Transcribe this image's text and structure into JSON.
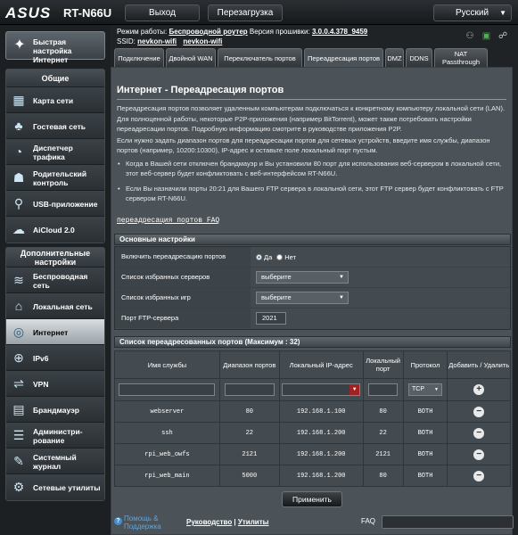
{
  "brand": {
    "logo": "ASUS",
    "model": "RT-N66U"
  },
  "topbar": {
    "logout": "Выход",
    "reboot": "Перезагрузка",
    "language": "Русский"
  },
  "info": {
    "mode_label": "Режим работы:",
    "mode_value": "Беспроводной роутер",
    "fw_label": "Версия прошивки:",
    "fw_value": "3.0.0.4.378_9459",
    "ssid_label": "SSID:",
    "ssid_values": [
      "nevkon-wifi",
      "nevkon-wifi"
    ]
  },
  "sidebar": {
    "quick": "Быстрая настройка Интернет",
    "general_head": "Общие",
    "general": [
      {
        "label": "Карта сети",
        "icon": "network-map-icon",
        "glyph": "▦"
      },
      {
        "label": "Гостевая сеть",
        "icon": "guest-network-icon",
        "glyph": "♣"
      },
      {
        "label": "Диспетчер трафика",
        "icon": "traffic-manager-icon",
        "glyph": "◔"
      },
      {
        "label": "Родительский контроль",
        "icon": "parental-control-icon",
        "glyph": "☗"
      },
      {
        "label": "USB-приложение",
        "icon": "usb-app-icon",
        "glyph": "⚲"
      },
      {
        "label": "AiCloud 2.0",
        "icon": "aicloud-icon",
        "glyph": "☁"
      }
    ],
    "advanced_head": "Дополнительные настройки",
    "advanced": [
      {
        "label": "Беспроводная сеть",
        "icon": "wireless-icon",
        "glyph": "≋"
      },
      {
        "label": "Локальная сеть",
        "icon": "lan-icon",
        "glyph": "⌂"
      },
      {
        "label": "Интернет",
        "icon": "internet-icon",
        "glyph": "◎",
        "active": true
      },
      {
        "label": "IPv6",
        "icon": "ipv6-icon",
        "glyph": "⊕"
      },
      {
        "label": "VPN",
        "icon": "vpn-icon",
        "glyph": "⇌"
      },
      {
        "label": "Брандмауэр",
        "icon": "firewall-icon",
        "glyph": "▤"
      },
      {
        "label": "Администри-рование",
        "icon": "administration-icon",
        "glyph": "☰"
      },
      {
        "label": "Системный журнал",
        "icon": "system-log-icon",
        "glyph": "✎"
      },
      {
        "label": "Сетевые утилиты",
        "icon": "network-tools-icon",
        "glyph": "⚙"
      }
    ]
  },
  "tabs": [
    "Подключение",
    "Двойной WAN",
    "Переключатель портов",
    "Переадресация портов",
    "DMZ",
    "DDNS",
    "NAT Passthrough"
  ],
  "page": {
    "title": "Интернет - Переадресация портов",
    "desc1": "Переадресация портов позволяет удаленным компьютерам подключаться к конкретному компьютеру локальной сети (LAN). Для полноценной работы, некоторые P2P-приложения (например BitTorrent), может также потребовать настройки переадресации портов. Подробную информацию смотрите в руководстве приложения P2P.",
    "desc2": "Если нужно задать диапазон портов для переадресации портов для сетевых устройств, введите имя службы, диапазон портов (например, 10200:10300), IP-адрес и оставьте поле локальный порт пустым.",
    "bullet1": "Когда в Вашей сети отключен брандмауэр и Вы установили 80 порт для использования веб-сервером в локальной сети, этот веб-сервер будет конфликтовать с веб-интерфейсом RT-N66U.",
    "bullet2": "Если Вы назначили порты 20:21 для Вашего FTP сервера в локальной сети, этот FTP сервер будет конфликтовать с FTP сервером RT-N66U.",
    "faq": "переадресация портов FAQ"
  },
  "basic": {
    "head": "Основные настройки",
    "enable_label": "Включить переадресацию портов",
    "yes": "Да",
    "no": "Нет",
    "fav_servers_label": "Список избранных серверов",
    "fav_servers_value": "выберите",
    "fav_games_label": "Список избранных игр",
    "fav_games_value": "выберите",
    "ftp_port_label": "Порт FTP-сервера",
    "ftp_port_value": "2021"
  },
  "list": {
    "head": "Список переадресованных портов (Максимум : 32)",
    "columns": [
      "Имя службы",
      "Диапазон портов",
      "Локальный IP-адрес",
      "Локальный порт",
      "Протокол",
      "Добавить / Удалить"
    ],
    "protocol_default": "TCP",
    "rows": [
      {
        "name": "webserver",
        "range": "80",
        "ip": "192.168.1.100",
        "port": "80",
        "proto": "BOTH"
      },
      {
        "name": "ssh",
        "range": "22",
        "ip": "192.168.1.200",
        "port": "22",
        "proto": "BOTH"
      },
      {
        "name": "rpi_web_owfs",
        "range": "2121",
        "ip": "192.168.1.200",
        "port": "2121",
        "proto": "BOTH"
      },
      {
        "name": "rpi_web_main",
        "range": "5000",
        "ip": "192.168.1.200",
        "port": "80",
        "proto": "BOTH"
      }
    ]
  },
  "apply": "Применить",
  "footer": {
    "help": "Помощь & Поддержка",
    "manual": "Руководство",
    "sep": " | ",
    "utilities": "Утилиты",
    "faq": "FAQ"
  }
}
